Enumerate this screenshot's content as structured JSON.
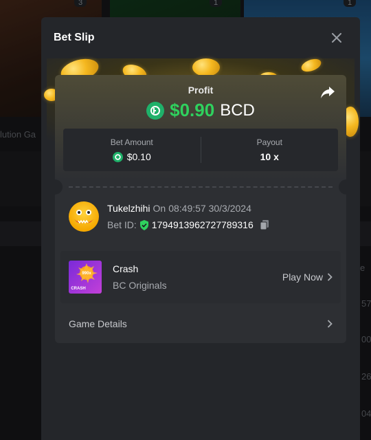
{
  "background": {
    "card_counts": [
      "3",
      "1",
      "1"
    ],
    "partial_label": "lution Ga",
    "right_header": "e",
    "right_values": [
      "57",
      "00",
      "26",
      "04"
    ]
  },
  "modal": {
    "title": "Bet Slip",
    "profit": {
      "label": "Profit",
      "value": "$0.90",
      "currency": "BCD"
    },
    "bet_amount": {
      "label": "Bet Amount",
      "value": "$0.10"
    },
    "payout": {
      "label": "Payout",
      "value": "10 x"
    },
    "user": {
      "name": "Tukelzhihi",
      "on_label": "On",
      "timestamp": "08:49:57 30/3/2024",
      "bet_id_label": "Bet ID:",
      "bet_id": "1794913962727789316"
    },
    "game": {
      "name": "Crash",
      "provider": "BC Originals",
      "thumb_text": "CRASH",
      "thumb_badge": "990x",
      "play_label": "Play Now"
    },
    "details_label": "Game Details"
  },
  "colors": {
    "profit_green": "#2fd15e",
    "bcd_coin": "#1fb16a",
    "modal_bg": "#24262a",
    "card_bg": "#2d2f33"
  },
  "icons": [
    "close-icon",
    "share-icon",
    "bcd-coin-icon",
    "shield-check-icon",
    "copy-icon",
    "chevron-right-icon"
  ]
}
